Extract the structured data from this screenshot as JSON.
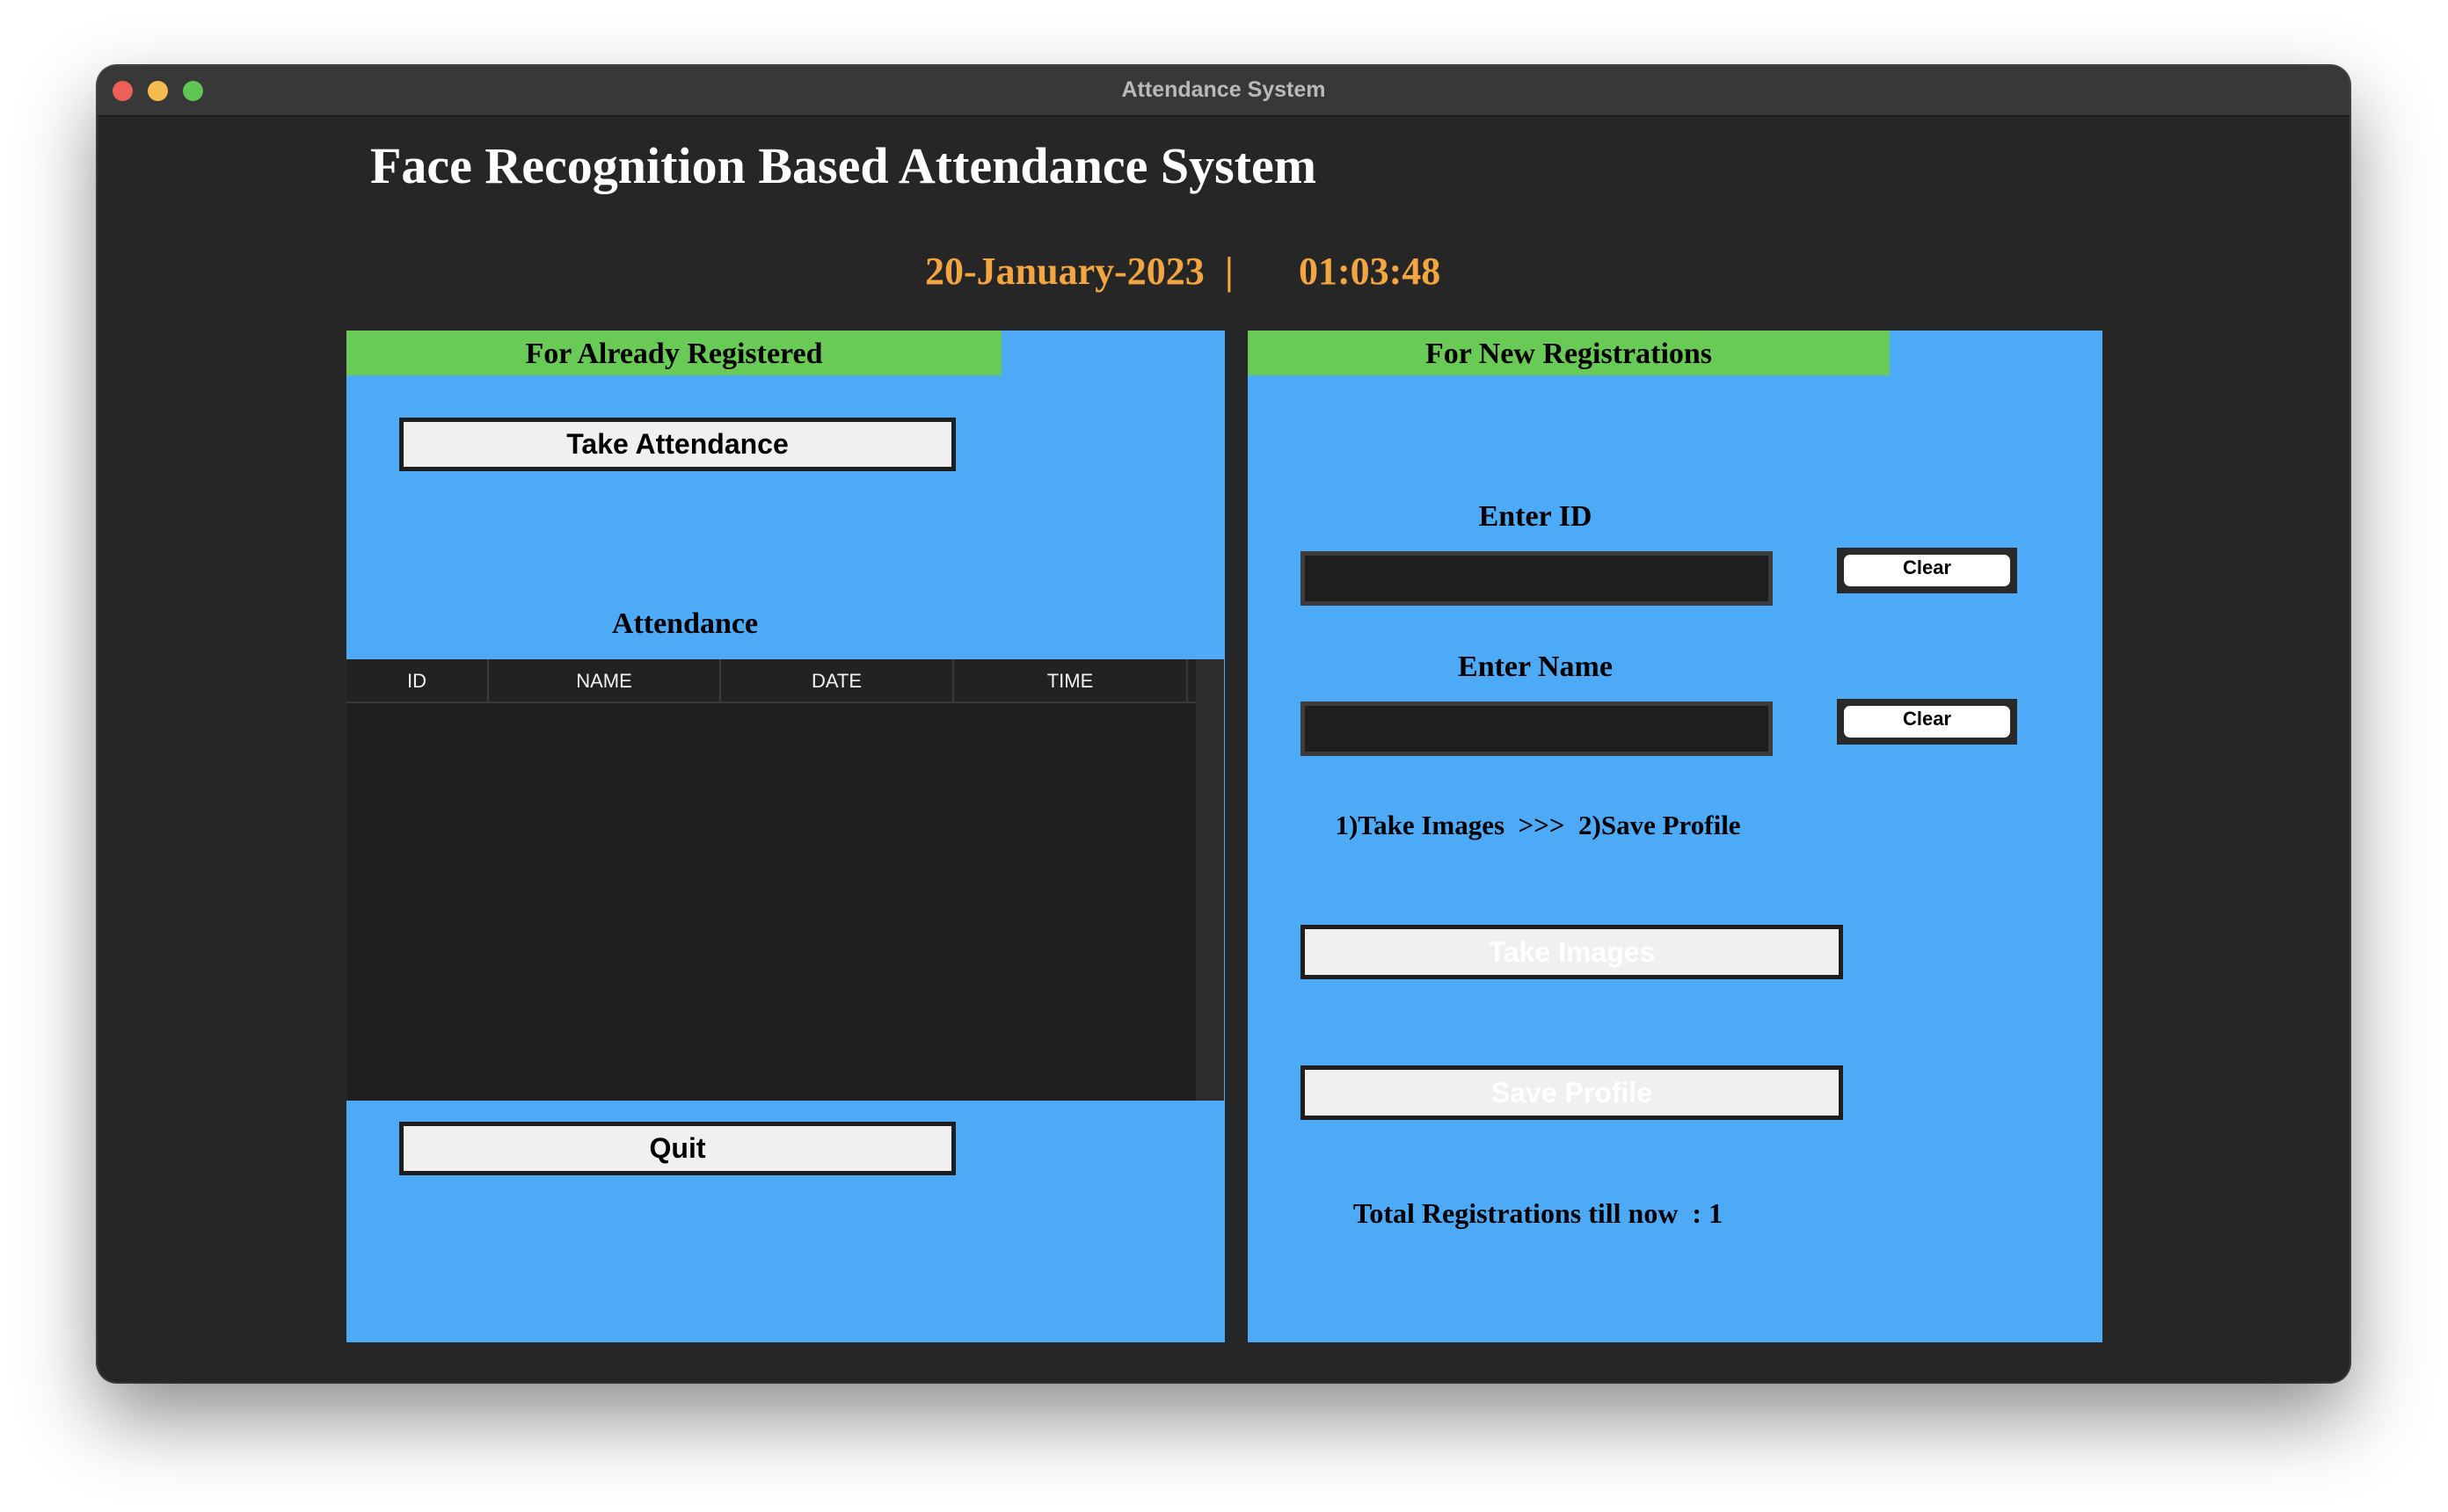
{
  "window": {
    "title": "Attendance System"
  },
  "app": {
    "title": "Face Recognition Based Attendance System",
    "date": "20-January-2023",
    "separator": "|",
    "time": "01:03:48"
  },
  "left_panel": {
    "header": "For Already Registered",
    "take_attendance_label": "Take Attendance",
    "attendance_label": "Attendance",
    "table": {
      "columns": [
        "ID",
        "NAME",
        "DATE",
        "TIME"
      ],
      "rows": []
    },
    "quit_label": "Quit"
  },
  "right_panel": {
    "header": "For New Registrations",
    "enter_id_label": "Enter ID",
    "id_value": "",
    "clear_label": "Clear",
    "enter_name_label": "Enter Name",
    "name_value": "",
    "steps_text": "1)Take Images  >>>  2)Save Profile",
    "take_images_label": "Take Images",
    "save_profile_label": "Save Profile",
    "total_text": "Total Registrations till now  : 1"
  },
  "colors": {
    "panel_bg": "#4daaf6",
    "header_bg": "#6aca56",
    "datetime": "#f2a540",
    "window_bg": "#262626"
  }
}
